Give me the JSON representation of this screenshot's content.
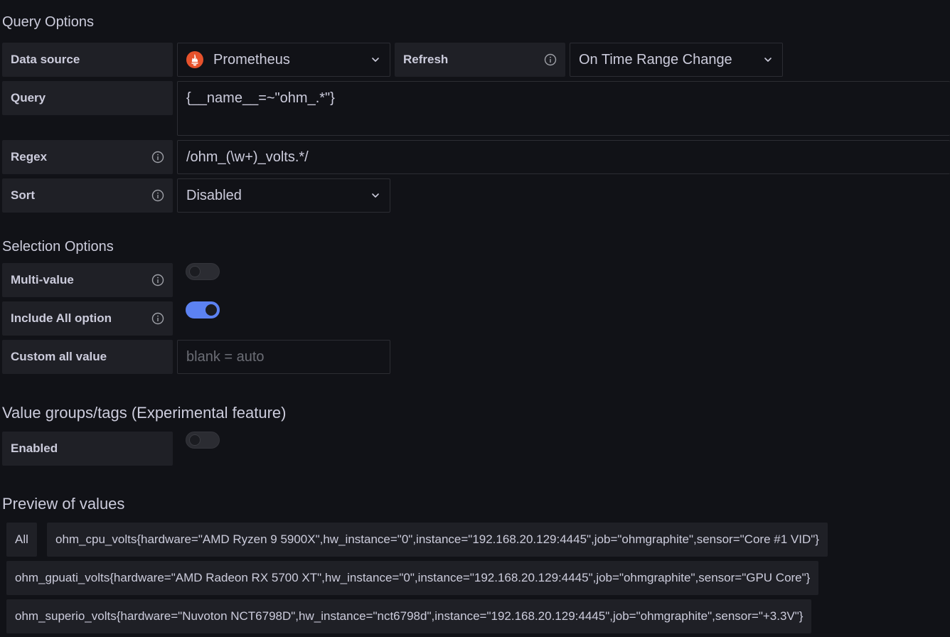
{
  "query_options": {
    "title": "Query Options",
    "data_source_label": "Data source",
    "data_source_value": "Prometheus",
    "refresh_label": "Refresh",
    "refresh_value": "On Time Range Change",
    "query_label": "Query",
    "query_value": "{__name__=~\"ohm_.*\"}",
    "regex_label": "Regex",
    "regex_value": "/ohm_(\\w+)_volts.*/",
    "sort_label": "Sort",
    "sort_value": "Disabled"
  },
  "selection_options": {
    "title": "Selection Options",
    "multi_value_label": "Multi-value",
    "multi_value_enabled": false,
    "include_all_label": "Include All option",
    "include_all_enabled": true,
    "custom_all_label": "Custom all value",
    "custom_all_placeholder": "blank = auto"
  },
  "value_groups": {
    "title": "Value groups/tags (Experimental feature)",
    "enabled_label": "Enabled",
    "enabled": false
  },
  "preview": {
    "title": "Preview of values",
    "values": [
      "All",
      "ohm_cpu_volts{hardware=\"AMD Ryzen 9 5900X\",hw_instance=\"0\",instance=\"192.168.20.129:4445\",job=\"ohmgraphite\",sensor=\"Core #1 VID\"}",
      "ohm_gpuati_volts{hardware=\"AMD Radeon RX 5700 XT\",hw_instance=\"0\",instance=\"192.168.20.129:4445\",job=\"ohmgraphite\",sensor=\"GPU Core\"}",
      "ohm_superio_volts{hardware=\"Nuvoton NCT6798D\",hw_instance=\"nct6798d\",instance=\"192.168.20.129:4445\",job=\"ohmgraphite\",sensor=\"+3.3V\"}"
    ]
  },
  "colors": {
    "background": "#111217",
    "label_bg": "#1f2026",
    "toggle_on": "#5c82f2",
    "prometheus": "#e6522c"
  },
  "icons": {
    "info": "info-circle-icon",
    "chevron": "chevron-down-icon",
    "datasource": "prometheus-logo-icon"
  }
}
